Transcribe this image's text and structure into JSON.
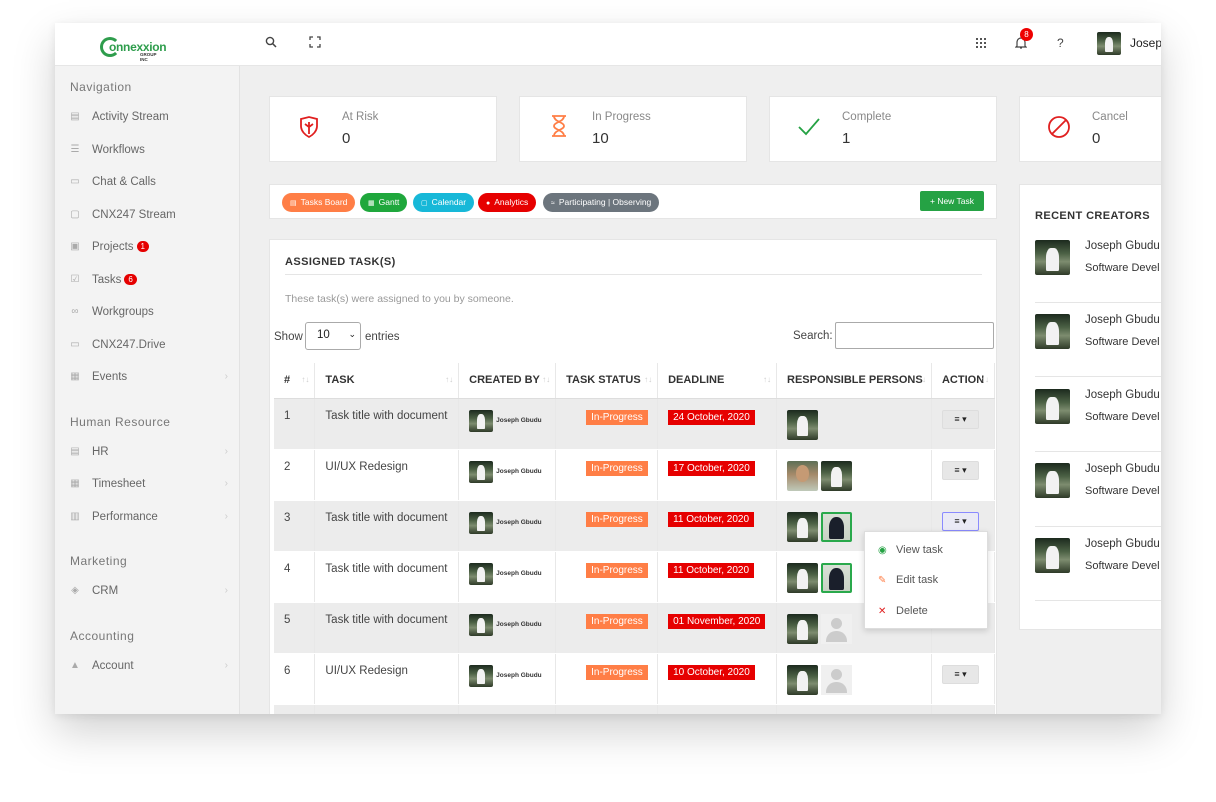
{
  "header": {
    "logo_text": "onnexxion",
    "logo_sub": "GROUP INC",
    "notifications_count": "8",
    "user_name": "Joseph"
  },
  "sidebar": {
    "sections": {
      "navigation": "Navigation",
      "human_resource": "Human Resource",
      "marketing": "Marketing",
      "accounting": "Accounting"
    },
    "items": [
      {
        "label": "Activity Stream",
        "icon": "activity-icon",
        "badge": ""
      },
      {
        "label": "Workflows",
        "icon": "list-icon",
        "badge": ""
      },
      {
        "label": "Chat & Calls",
        "icon": "chat-icon",
        "badge": ""
      },
      {
        "label": "CNX247 Stream",
        "icon": "stream-icon",
        "badge": ""
      },
      {
        "label": "Projects",
        "icon": "briefcase-icon",
        "badge": "1"
      },
      {
        "label": "Tasks",
        "icon": "checkbox-icon",
        "badge": "6"
      },
      {
        "label": "Workgroups",
        "icon": "infinity-icon",
        "badge": ""
      },
      {
        "label": "CNX247.Drive",
        "icon": "drive-icon",
        "badge": ""
      },
      {
        "label": "Events",
        "icon": "calendar-icon",
        "badge": ""
      },
      {
        "label": "HR",
        "icon": "id-card-icon",
        "badge": ""
      },
      {
        "label": "Timesheet",
        "icon": "calendar-icon",
        "badge": ""
      },
      {
        "label": "Performance",
        "icon": "bar-chart-icon",
        "badge": ""
      },
      {
        "label": "CRM",
        "icon": "cube-icon",
        "badge": ""
      },
      {
        "label": "Account",
        "icon": "flask-icon",
        "badge": ""
      }
    ]
  },
  "stats": [
    {
      "label": "At Risk",
      "value": "0",
      "icon": "shield-icon",
      "color": "#e02020"
    },
    {
      "label": "In Progress",
      "value": "10",
      "icon": "hourglass-icon",
      "color": "#ff7e46"
    },
    {
      "label": "Complete",
      "value": "1",
      "icon": "check-icon",
      "color": "#25a244"
    },
    {
      "label": "Cancel",
      "value": "0",
      "icon": "ban-icon",
      "color": "#e02020"
    }
  ],
  "toolbar": {
    "pills": [
      {
        "label": "Tasks Board",
        "color": "#ff7e46"
      },
      {
        "label": "Gantt",
        "color": "#1fa73c"
      },
      {
        "label": "Calendar",
        "color": "#17b8d8"
      },
      {
        "label": "Analytics",
        "color": "#e60000"
      },
      {
        "label": "Participating | Observing",
        "color": "#6c757d"
      }
    ],
    "new_task": "New Task"
  },
  "tasks_panel": {
    "title": "ASSIGNED TASK(S)",
    "subtitle": "These task(s) were assigned to you by someone.",
    "show_label": "Show",
    "page_size": "10",
    "entries_label": "entries",
    "search_label": "Search:",
    "columns": [
      "#",
      "TASK",
      "CREATED BY",
      "TASK STATUS",
      "DEADLINE",
      "RESPONSIBLE PERSONS",
      "ACTION"
    ],
    "rows": [
      {
        "num": "1",
        "task": "Task title with document",
        "created_by": "Joseph Gbudu",
        "status": "In-Progress",
        "deadline": "24 October, 2020"
      },
      {
        "num": "2",
        "task": "UI/UX Redesign",
        "created_by": "Joseph Gbudu",
        "status": "In-Progress",
        "deadline": "17 October, 2020"
      },
      {
        "num": "3",
        "task": "Task title with document",
        "created_by": "Joseph Gbudu",
        "status": "In-Progress",
        "deadline": "11 October, 2020"
      },
      {
        "num": "4",
        "task": "Task title with document",
        "created_by": "Joseph Gbudu",
        "status": "In-Progress",
        "deadline": "11 October, 2020"
      },
      {
        "num": "5",
        "task": "Task title with document",
        "created_by": "Joseph Gbudu",
        "status": "In-Progress",
        "deadline": "01 November, 2020"
      },
      {
        "num": "6",
        "task": "UI/UX Redesign",
        "created_by": "Joseph Gbudu",
        "status": "In-Progress",
        "deadline": "10 October, 2020"
      }
    ],
    "action_menu": [
      "View task",
      "Edit task",
      "Delete"
    ]
  },
  "recent_creators": {
    "title": "RECENT CREATORS",
    "items": [
      {
        "name": "Joseph Gbudu",
        "role": "Software Devel"
      },
      {
        "name": "Joseph Gbudu",
        "role": "Software Devel"
      },
      {
        "name": "Joseph Gbudu",
        "role": "Software Devel"
      },
      {
        "name": "Joseph Gbudu",
        "role": "Software Devel"
      },
      {
        "name": "Joseph Gbudu",
        "role": "Software Devel"
      }
    ]
  }
}
